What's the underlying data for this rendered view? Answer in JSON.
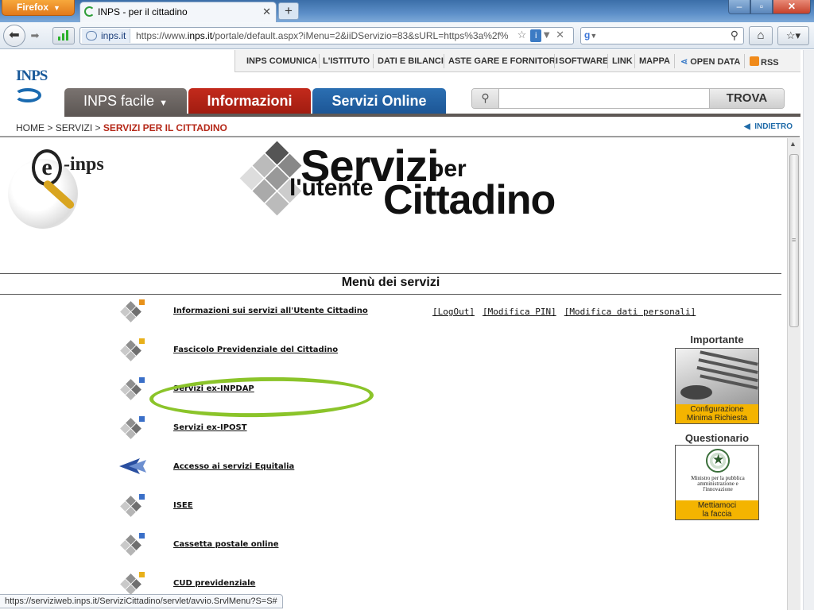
{
  "browser": {
    "app_button": "Firefox",
    "tab_title": "INPS - per il cittadino",
    "new_tab": "+",
    "site_identity": "inps.it",
    "url_prefix": "https://www.",
    "url_domain": "inps.it",
    "url_rest": "/portale/default.aspx?iMenu=2&iiDServizio=83&sURL=https%3a%2f%",
    "status_url": "https://serviziweb.inps.it/ServiziCittadino/servlet/avvio.SrvlMenu?S=S#"
  },
  "site": {
    "logo": "INPS",
    "top_links": [
      "INPS COMUNICA",
      "L'ISTITUTO",
      "DATI E BILANCI",
      "ASTE GARE E FORNITORI",
      "SOFTWARE",
      "LINK",
      "MAPPA",
      "OPEN DATA",
      "RSS"
    ],
    "tabs": {
      "facile": "INPS facile",
      "info": "Informazioni",
      "online": "Servizi Online"
    },
    "search_button": "TROVA",
    "breadcrumb": {
      "home": "HOME",
      "servizi": "SERVIZI",
      "current": "SERVIZI PER IL CITTADINO"
    },
    "back_link": "INDIETRO"
  },
  "frame": {
    "einps_logo": "e-inps",
    "banner": {
      "w1": "Servizi",
      "w2": "per",
      "w3": "l'utente",
      "w4": "Cittadino"
    },
    "menu_title": "Menù dei servizi",
    "account_links": [
      "[LogOut]",
      "[Modifica PIN]",
      "[Modifica dati personali]"
    ],
    "services": [
      {
        "label": "Informazioni sui servizi all'Utente Cittadino",
        "accent": "#e8911a"
      },
      {
        "label": "Fascicolo Previdenziale del Cittadino",
        "accent": "#e8b01a"
      },
      {
        "label": "Servizi ex-INPDAP",
        "accent": "#3a6fc8"
      },
      {
        "label": "Servizi ex-IPOST",
        "accent": "#3a6fc8"
      },
      {
        "label": "Accesso ai servizi Equitalia",
        "accent": "#2a4fa0"
      },
      {
        "label": "ISEE",
        "accent": "#3a6fc8"
      },
      {
        "label": "Cassetta postale online",
        "accent": "#3a6fc8"
      },
      {
        "label": "CUD previdenziale",
        "accent": "#e8b01a"
      }
    ],
    "sidebar": {
      "importante_title": "Importante",
      "importante_caption_1": "Configurazione",
      "importante_caption_2": "Minima Richiesta",
      "questionario_title": "Questionario",
      "ministero_text": "Ministro per la pubblica amministrazione e l'innovazione",
      "questionario_caption_1": "Mettiamoci",
      "questionario_caption_2": "la faccia"
    }
  },
  "colors": {
    "tab_facile": "#6b6562",
    "tab_info": "#b2241a",
    "tab_online": "#2464a8",
    "highlight_ellipse": "#8bc42a",
    "caption_bg": "#f4b400"
  }
}
